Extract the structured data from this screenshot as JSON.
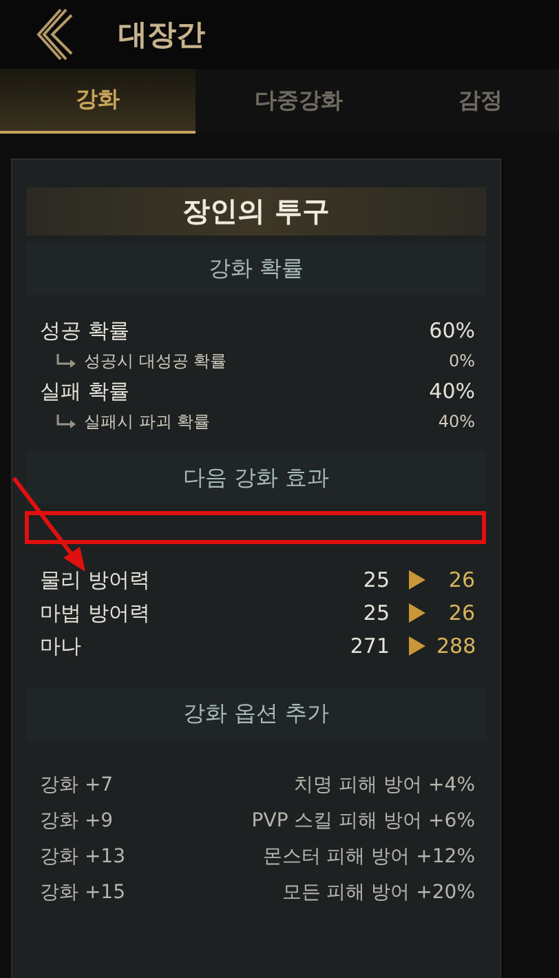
{
  "header": {
    "title": "대장간"
  },
  "tabs": [
    {
      "label": "강화",
      "selected": true
    },
    {
      "label": "다중강화",
      "selected": false
    },
    {
      "label": "감정",
      "selected": false
    }
  ],
  "item": {
    "name": "장인의 투구"
  },
  "probability": {
    "heading": "강화 확률",
    "rows": [
      {
        "kind": "main",
        "label": "성공 확률",
        "value": "60%"
      },
      {
        "kind": "sub",
        "label": "성공시 대성공 확률",
        "value": "0%"
      },
      {
        "kind": "main",
        "label": "실패 확률",
        "value": "40%"
      },
      {
        "kind": "sub",
        "label": "실패시 파괴 확률",
        "value": "40%"
      }
    ]
  },
  "next_effect": {
    "heading": "다음 강화 효과",
    "stats": [
      {
        "label": "물리 방어력",
        "current": "25",
        "next": "26"
      },
      {
        "label": "마법 방어력",
        "current": "25",
        "next": "26"
      },
      {
        "label": "마나",
        "current": "271",
        "next": "288"
      }
    ]
  },
  "options": {
    "heading": "강화 옵션 추가",
    "rows": [
      {
        "level": "강화 +7",
        "effect": "치명 피해 방어 +4%"
      },
      {
        "level": "강화 +9",
        "effect": "PVP 스킬 피해 방어 +6%"
      },
      {
        "level": "강화 +13",
        "effect": "몬스터 피해 방어 +12%"
      },
      {
        "level": "강화 +15",
        "effect": "모든 피해 방어 +20%"
      }
    ]
  }
}
